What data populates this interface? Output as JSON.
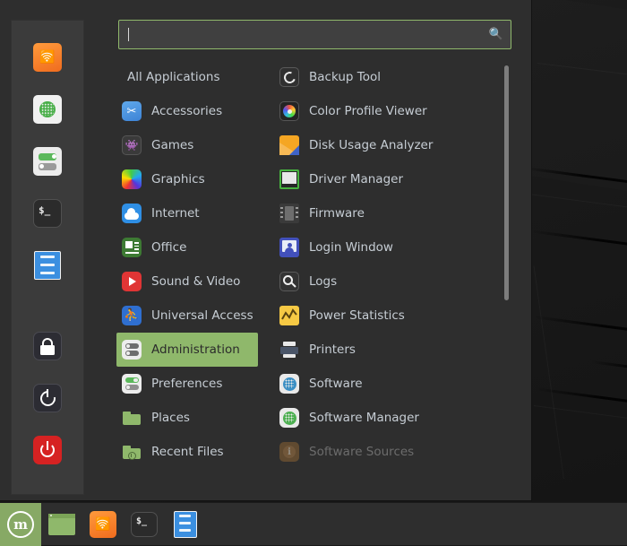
{
  "desktop": {
    "background_color": "#1b1b1b"
  },
  "menu": {
    "search": {
      "value": "",
      "placeholder": "",
      "icon": "search-icon",
      "border_color": "#8fb86b"
    },
    "categories": [
      {
        "label": "All Applications",
        "icon": "none",
        "selected": false
      },
      {
        "label": "Accessories",
        "icon": "scissors-icon",
        "selected": false
      },
      {
        "label": "Games",
        "icon": "game-controller-icon",
        "selected": false
      },
      {
        "label": "Graphics",
        "icon": "color-wheel-icon",
        "selected": false
      },
      {
        "label": "Internet",
        "icon": "cloud-icon",
        "selected": false
      },
      {
        "label": "Office",
        "icon": "document-icon",
        "selected": false
      },
      {
        "label": "Sound & Video",
        "icon": "play-icon",
        "selected": false
      },
      {
        "label": "Universal Access",
        "icon": "accessibility-icon",
        "selected": false
      },
      {
        "label": "Administration",
        "icon": "admin-toggles-icon",
        "selected": true
      },
      {
        "label": "Preferences",
        "icon": "prefs-toggles-icon",
        "selected": false
      },
      {
        "label": "Places",
        "icon": "folder-icon",
        "selected": false
      },
      {
        "label": "Recent Files",
        "icon": "folder-clock-icon",
        "selected": false
      }
    ],
    "applications": [
      {
        "label": "Backup Tool",
        "icon": "backup-icon",
        "dimmed": false
      },
      {
        "label": "Color Profile Viewer",
        "icon": "color-profile-icon",
        "dimmed": false
      },
      {
        "label": "Disk Usage Analyzer",
        "icon": "disk-usage-icon",
        "dimmed": false
      },
      {
        "label": "Driver Manager",
        "icon": "driver-manager-icon",
        "dimmed": false
      },
      {
        "label": "Firmware",
        "icon": "chip-icon",
        "dimmed": false
      },
      {
        "label": "Login Window",
        "icon": "login-window-icon",
        "dimmed": false
      },
      {
        "label": "Logs",
        "icon": "magnifier-icon",
        "dimmed": false
      },
      {
        "label": "Power Statistics",
        "icon": "power-statistics-icon",
        "dimmed": false
      },
      {
        "label": "Printers",
        "icon": "printer-icon",
        "dimmed": false
      },
      {
        "label": "Software",
        "icon": "software-icon",
        "dimmed": false
      },
      {
        "label": "Software Manager",
        "icon": "software-manager-icon",
        "dimmed": false
      },
      {
        "label": "Software Sources",
        "icon": "software-sources-icon",
        "dimmed": true
      }
    ],
    "favorites": [
      {
        "name": "Firefox Web Browser",
        "icon": "firefox-icon"
      },
      {
        "name": "Software Manager",
        "icon": "software-manager-icon"
      },
      {
        "name": "System Settings",
        "icon": "settings-toggles-icon"
      },
      {
        "name": "Terminal",
        "icon": "terminal-icon"
      },
      {
        "name": "Files",
        "icon": "files-icon"
      },
      {
        "name": "Lock Screen",
        "icon": "lock-icon"
      },
      {
        "name": "Log Out",
        "icon": "logout-icon"
      },
      {
        "name": "Quit",
        "icon": "power-icon"
      }
    ],
    "scrollbar": {
      "visible": true,
      "thumb_color": "#7d7d7d"
    }
  },
  "taskbar": {
    "menu_button": {
      "label": "Menu",
      "icon": "mint-logo-icon",
      "highlight_color": "#87a965"
    },
    "items": [
      {
        "name": "Show Desktop",
        "icon": "window-icon"
      },
      {
        "name": "Firefox Web Browser",
        "icon": "firefox-icon"
      },
      {
        "name": "Terminal",
        "icon": "terminal-icon"
      },
      {
        "name": "Files",
        "icon": "files-icon"
      }
    ]
  }
}
